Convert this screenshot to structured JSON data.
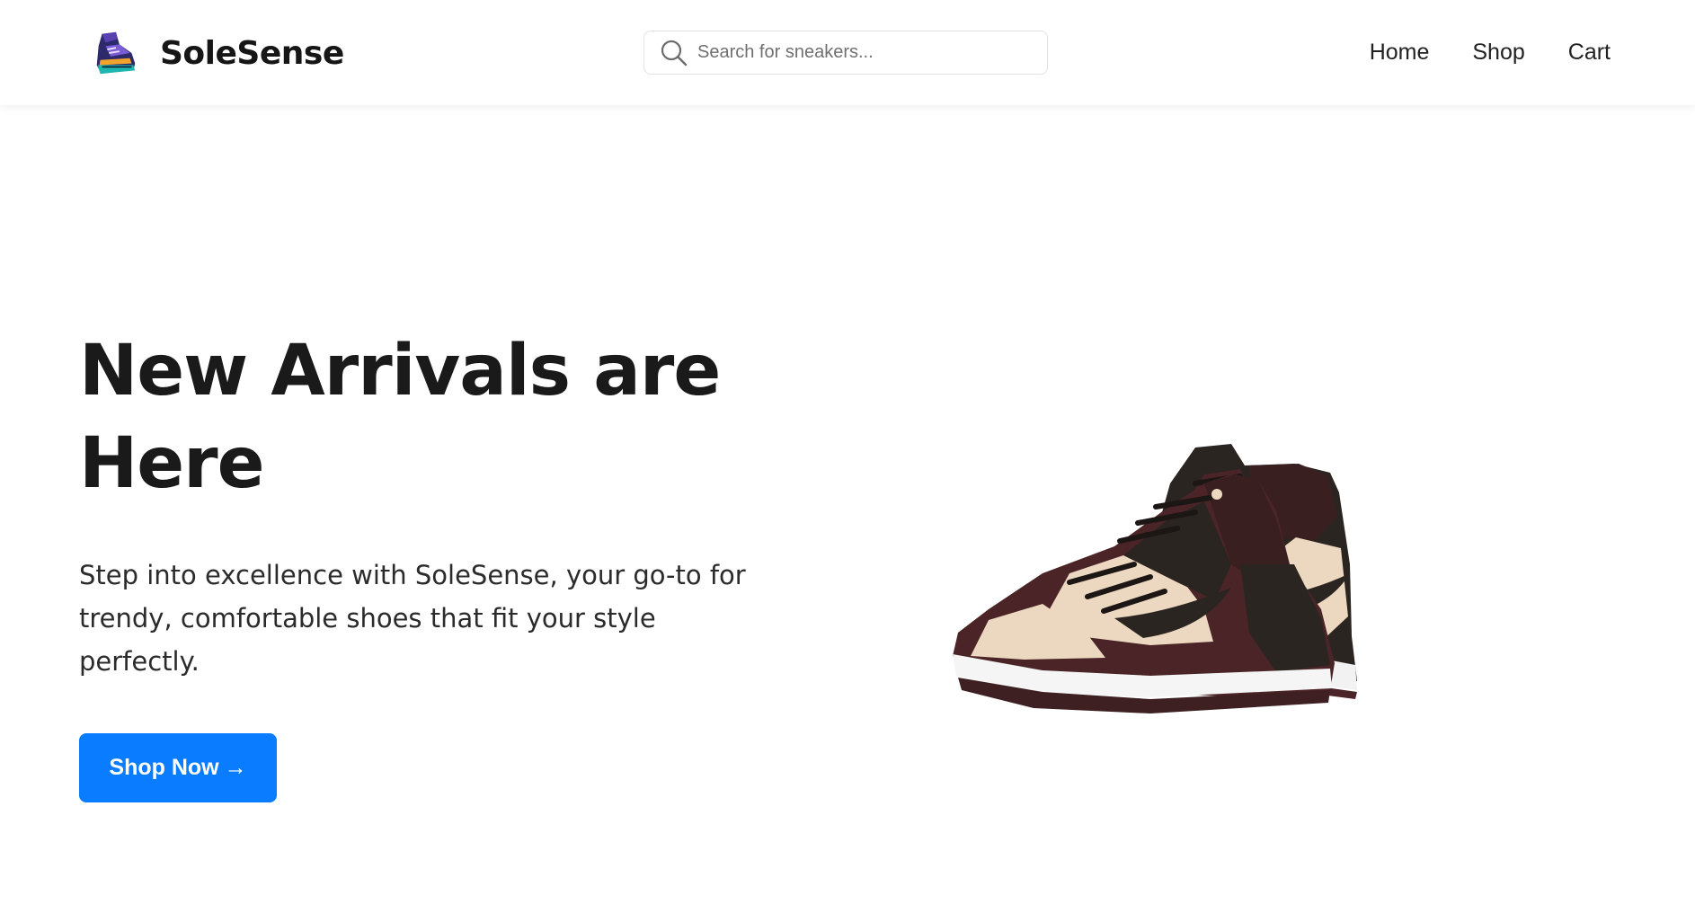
{
  "header": {
    "brand_name": "SoleSense",
    "logo_icon": "sneaker-logo-icon",
    "search": {
      "placeholder": "Search for sneakers...",
      "value": "",
      "icon": "search-icon"
    },
    "nav": [
      {
        "label": "Home"
      },
      {
        "label": "Shop"
      },
      {
        "label": "Cart"
      }
    ]
  },
  "hero": {
    "title": "New Arrivals are Here",
    "description": "Step into excellence with SoleSense, your go-to for trendy, comfortable shoes that fit your style perfectly.",
    "cta_label": "Shop Now",
    "cta_arrow": "→",
    "product_image": "pair-of-high-top-sneakers"
  },
  "colors": {
    "accent": "#0a7cff",
    "text": "#1a1a1a",
    "background": "#ffffff",
    "shoe_brown": "#4a2426",
    "shoe_cream": "#ecd8c0",
    "shoe_dark": "#2b2521"
  }
}
